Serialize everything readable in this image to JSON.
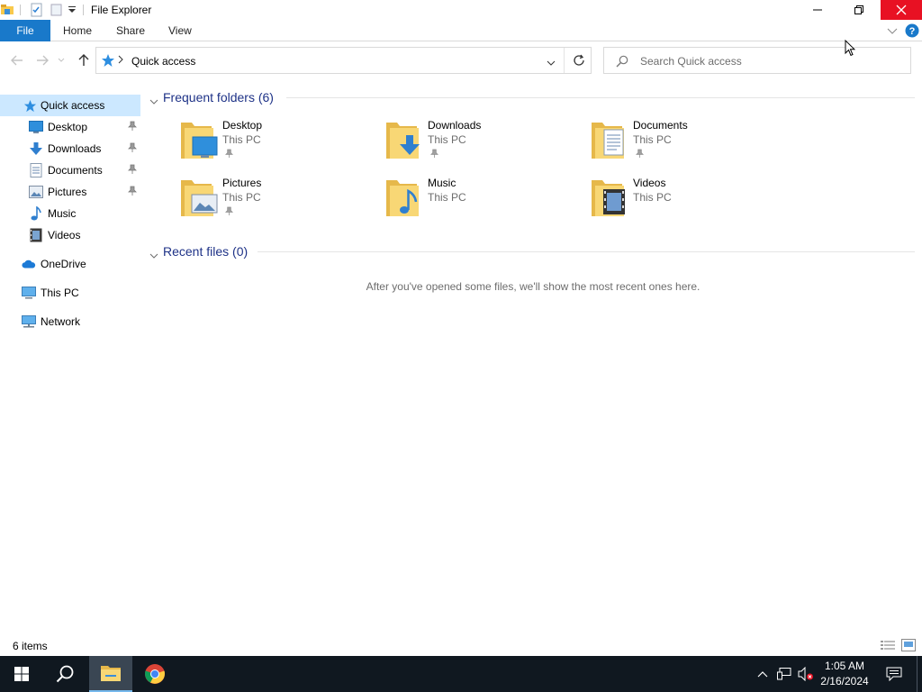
{
  "window": {
    "title": "File Explorer"
  },
  "ribbon": {
    "tabs": [
      {
        "label": "File",
        "active": true
      },
      {
        "label": "Home"
      },
      {
        "label": "Share"
      },
      {
        "label": "View"
      }
    ]
  },
  "address": {
    "path": "Quick access",
    "location_icon": "star-icon"
  },
  "search": {
    "placeholder": "Search Quick access"
  },
  "navigation": {
    "items": [
      {
        "label": "Quick access",
        "icon": "star-icon",
        "selected": true
      },
      {
        "label": "Desktop",
        "icon": "desktop-icon",
        "pinned": true
      },
      {
        "label": "Downloads",
        "icon": "download-arrow-icon",
        "pinned": true
      },
      {
        "label": "Documents",
        "icon": "document-icon",
        "pinned": true
      },
      {
        "label": "Pictures",
        "icon": "picture-icon",
        "pinned": true
      },
      {
        "label": "Music",
        "icon": "music-note-icon"
      },
      {
        "label": "Videos",
        "icon": "film-icon"
      },
      {
        "label": "OneDrive",
        "icon": "cloud-icon"
      },
      {
        "label": "This PC",
        "icon": "computer-icon"
      },
      {
        "label": "Network",
        "icon": "network-icon"
      }
    ]
  },
  "frequent_folders": {
    "header": "Frequent folders (6)",
    "folders": [
      {
        "name": "Desktop",
        "location": "This PC",
        "pinned": true
      },
      {
        "name": "Downloads",
        "location": "This PC",
        "pinned": true
      },
      {
        "name": "Documents",
        "location": "This PC",
        "pinned": true
      },
      {
        "name": "Pictures",
        "location": "This PC",
        "pinned": true
      },
      {
        "name": "Music",
        "location": "This PC",
        "pinned": false
      },
      {
        "name": "Videos",
        "location": "This PC",
        "pinned": false
      }
    ]
  },
  "recent_files": {
    "header": "Recent files (0)",
    "empty_message": "After you've opened some files, we'll show the most recent ones here."
  },
  "status": {
    "item_count": "6 items"
  },
  "taskbar": {
    "clock_time": "1:05 AM",
    "clock_date": "2/16/2024"
  },
  "colors": {
    "accent": "#1979ca",
    "selection": "#cce8ff",
    "group_header": "#1e3287",
    "close_hover": "#e81123",
    "taskbar": "#101820",
    "folder_yellow": "#f8d775"
  }
}
